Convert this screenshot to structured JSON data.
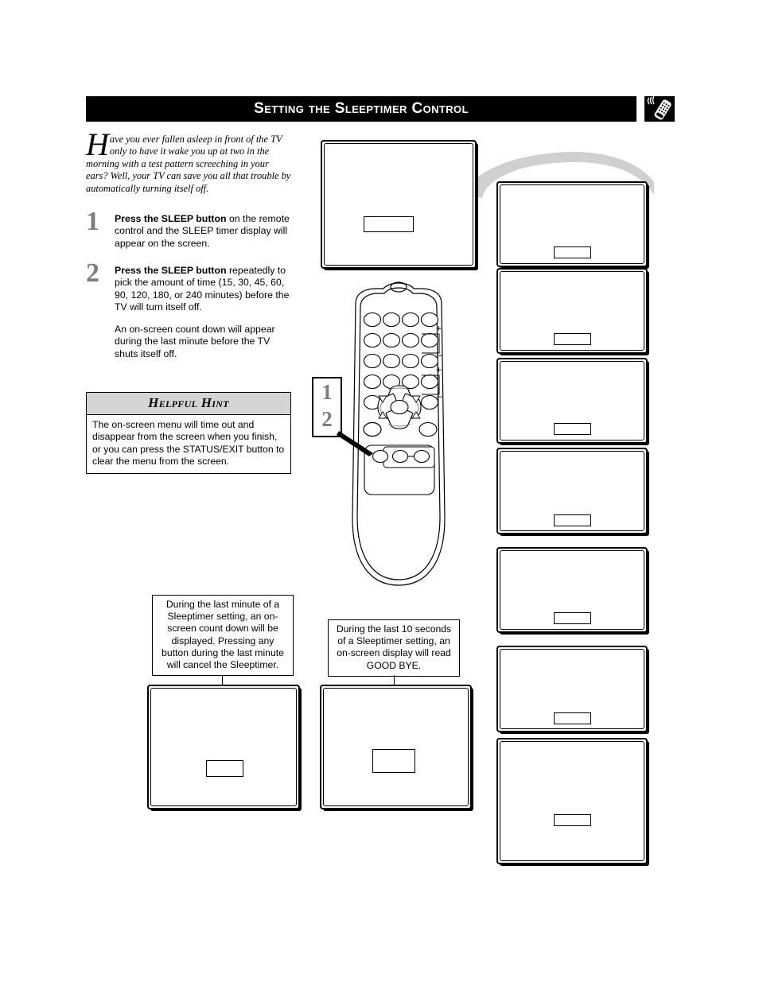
{
  "header": {
    "title": "Setting the Sleeptimer Control",
    "icon": "remote-control-icon"
  },
  "intro": {
    "dropcap": "H",
    "text": "ave you ever fallen asleep in front of the TV only to have it wake you up at two in the morning with a test pattern screeching in your ears? Well, your TV can save you all that trouble by automatically turning itself off."
  },
  "steps": [
    {
      "number": "1",
      "bold": "Press the SLEEP button",
      "rest": " on the remote control and the SLEEP timer display will appear on the screen."
    },
    {
      "number": "2",
      "bold": "Press the SLEEP button",
      "rest": " repeatedly to pick the amount of time (15, 30, 45, 60, 90, 120, 180, or 240 minutes) before the TV will turn itself off."
    }
  ],
  "subnote": "An on-screen count down will appear during the last minute before the TV shuts itself off.",
  "hint": {
    "heading": "Helpful Hint",
    "body": "The on-screen menu will time out and disappear from the screen when you finish, or you can press the STATUS/EXIT button to clear the menu from the screen."
  },
  "captions": {
    "left": "During the last minute of a Sleeptimer setting, an on-screen count down will be displayed. Pressing any button during the last minute will cancel the Sleeptimer.",
    "right": "During the last 10 seconds of a Sleeptimer setting, an on-screen display will read GOOD BYE."
  },
  "screens": {
    "main_osd": "",
    "stack_osd": [
      "",
      "",
      "",
      "",
      "",
      "",
      ""
    ],
    "bottom_left_osd": "",
    "bottom_right_osd": ""
  },
  "remote": {
    "callout_labels": [
      "1",
      "2"
    ],
    "volume_plus": "+",
    "volume_minus": "–",
    "channel_plus": "+",
    "channel_minus": "–"
  },
  "colors": {
    "header_bg": "#000000",
    "header_text": "#ffffff",
    "step_number": "#7d7d7d",
    "hint_header_bg": "#d4d4d4",
    "sweep_arrow": "#d0d0d0",
    "outline": "#000000"
  }
}
